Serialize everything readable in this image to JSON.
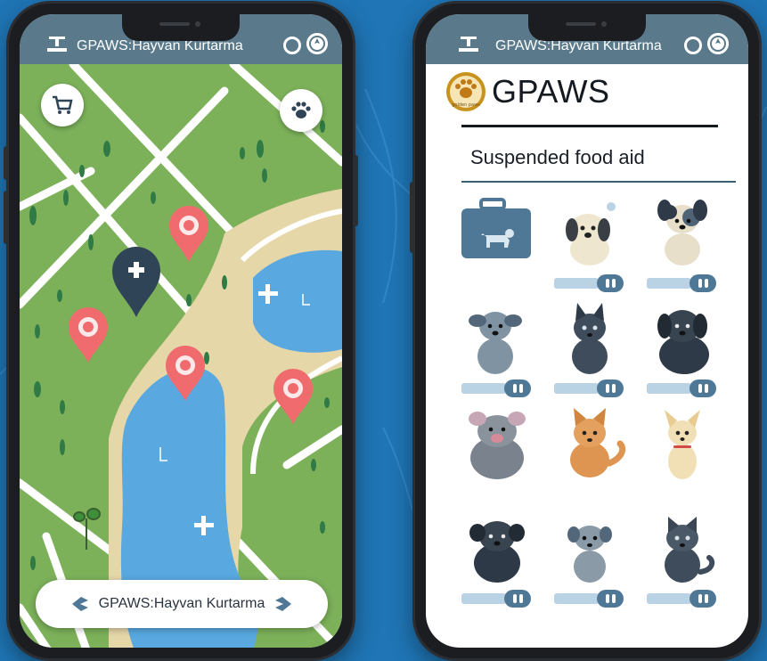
{
  "left_phone": {
    "status_title": "GPAWS:Hayvan Kurtarma",
    "icons": {
      "toolbar": "upload-tray-icon",
      "status_ring": "ring-icon",
      "status_compass": "compass-icon",
      "cart": "cart-icon",
      "paw": "paw-icon",
      "bottom_left": "back-arrow-icon",
      "bottom_right": "forward-arrow-icon"
    },
    "map_markers": [
      {
        "type": "vet-clinic",
        "color": "#2f4457"
      },
      {
        "type": "animal-red",
        "color": "#ef6b6d"
      },
      {
        "type": "animal-red",
        "color": "#ef6b6d"
      },
      {
        "type": "animal-red",
        "color": "#ef6b6d"
      },
      {
        "type": "animal-red",
        "color": "#ef6b6d"
      }
    ],
    "bottom_bar_title": "GPAWS:Hayvan Kurtarma"
  },
  "right_phone": {
    "status_title": "GPAWS:Hayvan Kurtarma",
    "brand": "GPAWS",
    "logo_caption": "golden paws",
    "section_title": "Suspended food aid",
    "animals": [
      {
        "name": "first-aid-kit"
      },
      {
        "name": "cream-puppy"
      },
      {
        "name": "spotted-puppy"
      },
      {
        "name": "grey-puppy"
      },
      {
        "name": "dark-cat"
      },
      {
        "name": "black-dog"
      },
      {
        "name": "grey-mouse"
      },
      {
        "name": "orange-fox"
      },
      {
        "name": "cream-chihuahua"
      },
      {
        "name": "black-puppy"
      },
      {
        "name": "slate-puppy"
      },
      {
        "name": "grey-cat"
      }
    ]
  },
  "colors": {
    "background": "#1f75b5",
    "header": "#5a7a8b",
    "map_grass": "#7cb15a",
    "map_water": "#59a8e0",
    "map_sand": "#e6d7a9",
    "marker_red": "#ef6b6d",
    "marker_dark": "#2f4457",
    "accent_blue": "#4f7896"
  }
}
